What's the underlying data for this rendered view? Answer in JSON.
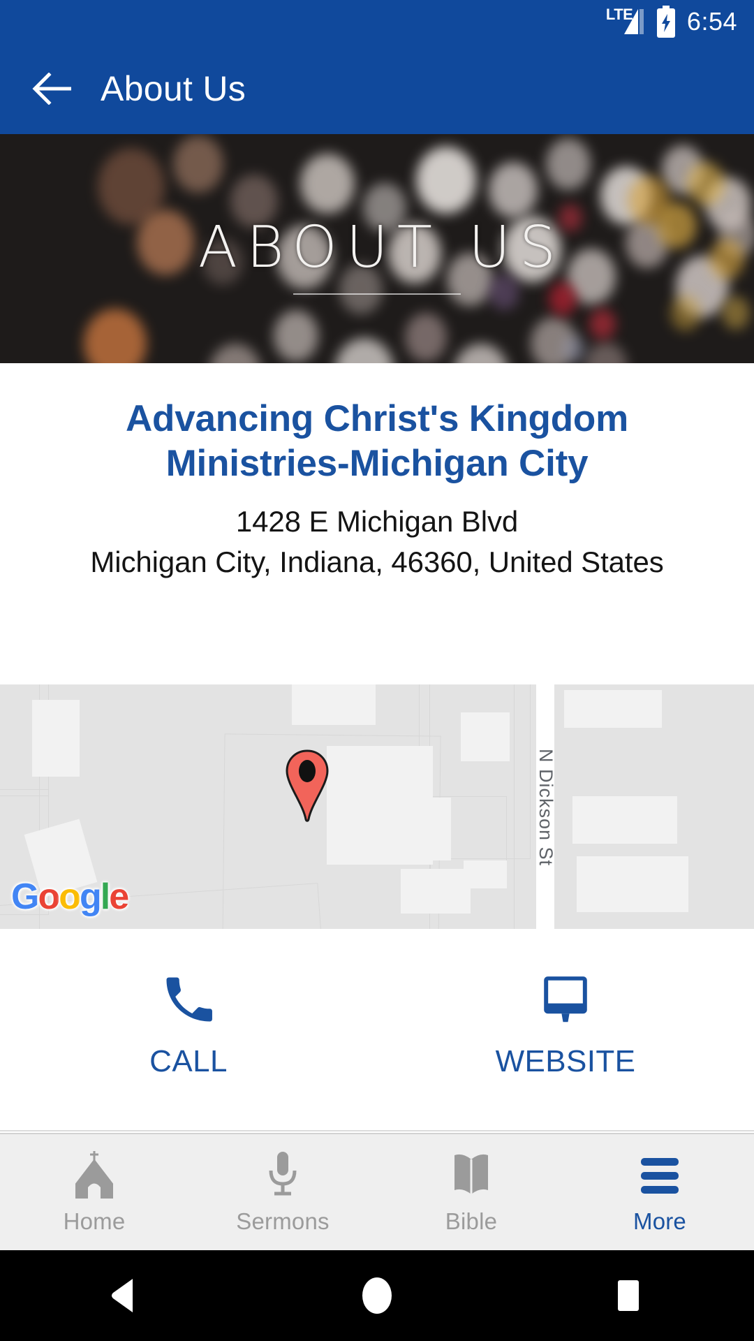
{
  "status_bar": {
    "network_label": "LTE",
    "signal_icon": "signal-bars-icon",
    "battery_icon": "battery-charging-icon",
    "time": "6:54"
  },
  "app_bar": {
    "back_icon": "back-arrow-icon",
    "title": "About Us"
  },
  "hero": {
    "title": "ABOUT US",
    "background": "bokeh-lights-photo"
  },
  "info": {
    "org_name": "Advancing Christ's Kingdom Ministries-Michigan City",
    "address_line1": "1428 E Michigan Blvd",
    "address_line2": "Michigan City, Indiana, 46360, United States"
  },
  "map": {
    "provider_logo": "google-logo",
    "provider_text": {
      "g1": "G",
      "o1": "o",
      "o2": "o",
      "g2": "g",
      "l": "l",
      "e": "e"
    },
    "street_label": "N Dickson St",
    "marker_icon": "map-pin-marker"
  },
  "actions": [
    {
      "label": "CALL",
      "icon": "phone-icon"
    },
    {
      "label": "WEBSITE",
      "icon": "monitor-icon"
    }
  ],
  "tabs": [
    {
      "label": "Home",
      "icon": "church-icon",
      "active": false
    },
    {
      "label": "Sermons",
      "icon": "microphone-icon",
      "active": false
    },
    {
      "label": "Bible",
      "icon": "open-book-icon",
      "active": false
    },
    {
      "label": "More",
      "icon": "hamburger-menu-icon",
      "active": true
    }
  ],
  "android_nav": [
    {
      "icon": "back-triangle-icon"
    },
    {
      "icon": "home-circle-icon"
    },
    {
      "icon": "recents-square-icon"
    }
  ],
  "colors": {
    "app_bar": "#10499C",
    "accent_blue": "#1A52A0",
    "tab_inactive": "#9B9B9B",
    "map_bg": "#E3E3E3",
    "marker_red": "#F2645A"
  }
}
